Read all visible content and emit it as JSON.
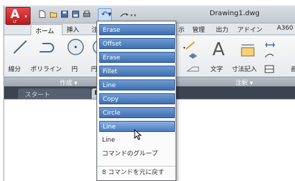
{
  "window": {
    "title": "Drawing1.dwg"
  },
  "app_button": {
    "logo": "A",
    "sub": "LT"
  },
  "tabs": [
    {
      "label": "ホーム"
    },
    {
      "label": "挿入"
    },
    {
      "label": "注"
    },
    {
      "label": "示"
    },
    {
      "label": "管理"
    },
    {
      "label": "出力"
    },
    {
      "label": "アドイン"
    },
    {
      "label": "A360"
    }
  ],
  "ribbon": {
    "draw_labels": [
      "線分",
      "ポリライン",
      "円",
      "円"
    ],
    "annot_labels": [
      "文字",
      "寸法記入"
    ],
    "right_label": "画",
    "panels": [
      "作成 ▾",
      "注釈 ▾"
    ]
  },
  "doc_tabs": {
    "start": "スタート",
    "drawing": "Dr"
  },
  "dropdown": {
    "items": [
      {
        "label": "Erase",
        "selected": true
      },
      {
        "label": "Offset",
        "selected": true
      },
      {
        "label": "Erase",
        "selected": true
      },
      {
        "label": "Fillet",
        "selected": true
      },
      {
        "label": "Line",
        "selected": true
      },
      {
        "label": "Copy",
        "selected": true
      },
      {
        "label": "Circle",
        "selected": true
      },
      {
        "label": "Line",
        "selected": true
      },
      {
        "label": "Line",
        "selected": false
      },
      {
        "label": "コマンドのグループ",
        "selected": false
      }
    ],
    "footer": "8 コマンドを元に戻す"
  },
  "colors": {
    "accent": "#3f6faf",
    "app_red": "#c62224"
  }
}
